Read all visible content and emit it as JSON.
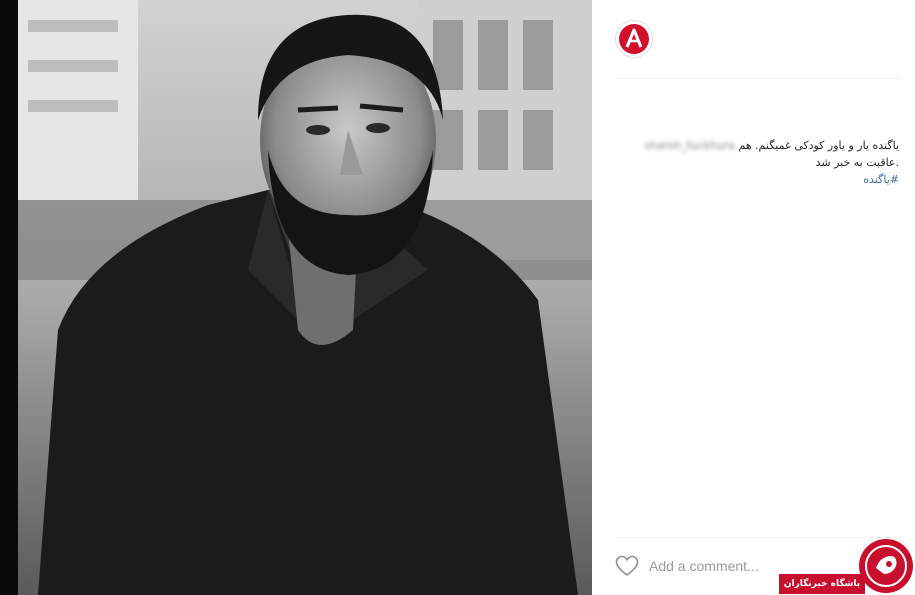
{
  "post": {
    "photo_alt": "black and white portrait of a bearded man in a dark shirt",
    "caption_name_blurred": "sharsh_fuckhura",
    "caption_line1": "یاگنده یار و یاور کودکی غمیگنم. هم",
    "caption_line2": ".عاقبت به خبر شد",
    "hashtag": "#یاگنده"
  },
  "comments": {
    "placeholder": "Add a comment..."
  },
  "watermark": {
    "text": "باشگاه خبرنگاران"
  },
  "colors": {
    "hashtag": "#3d6fa5",
    "watermark": "#c8102e",
    "avatar_logo": "#d0112b"
  },
  "icons": {
    "avatar": "a-logo-icon",
    "like": "heart-icon",
    "watermark": "news-logo-icon"
  }
}
